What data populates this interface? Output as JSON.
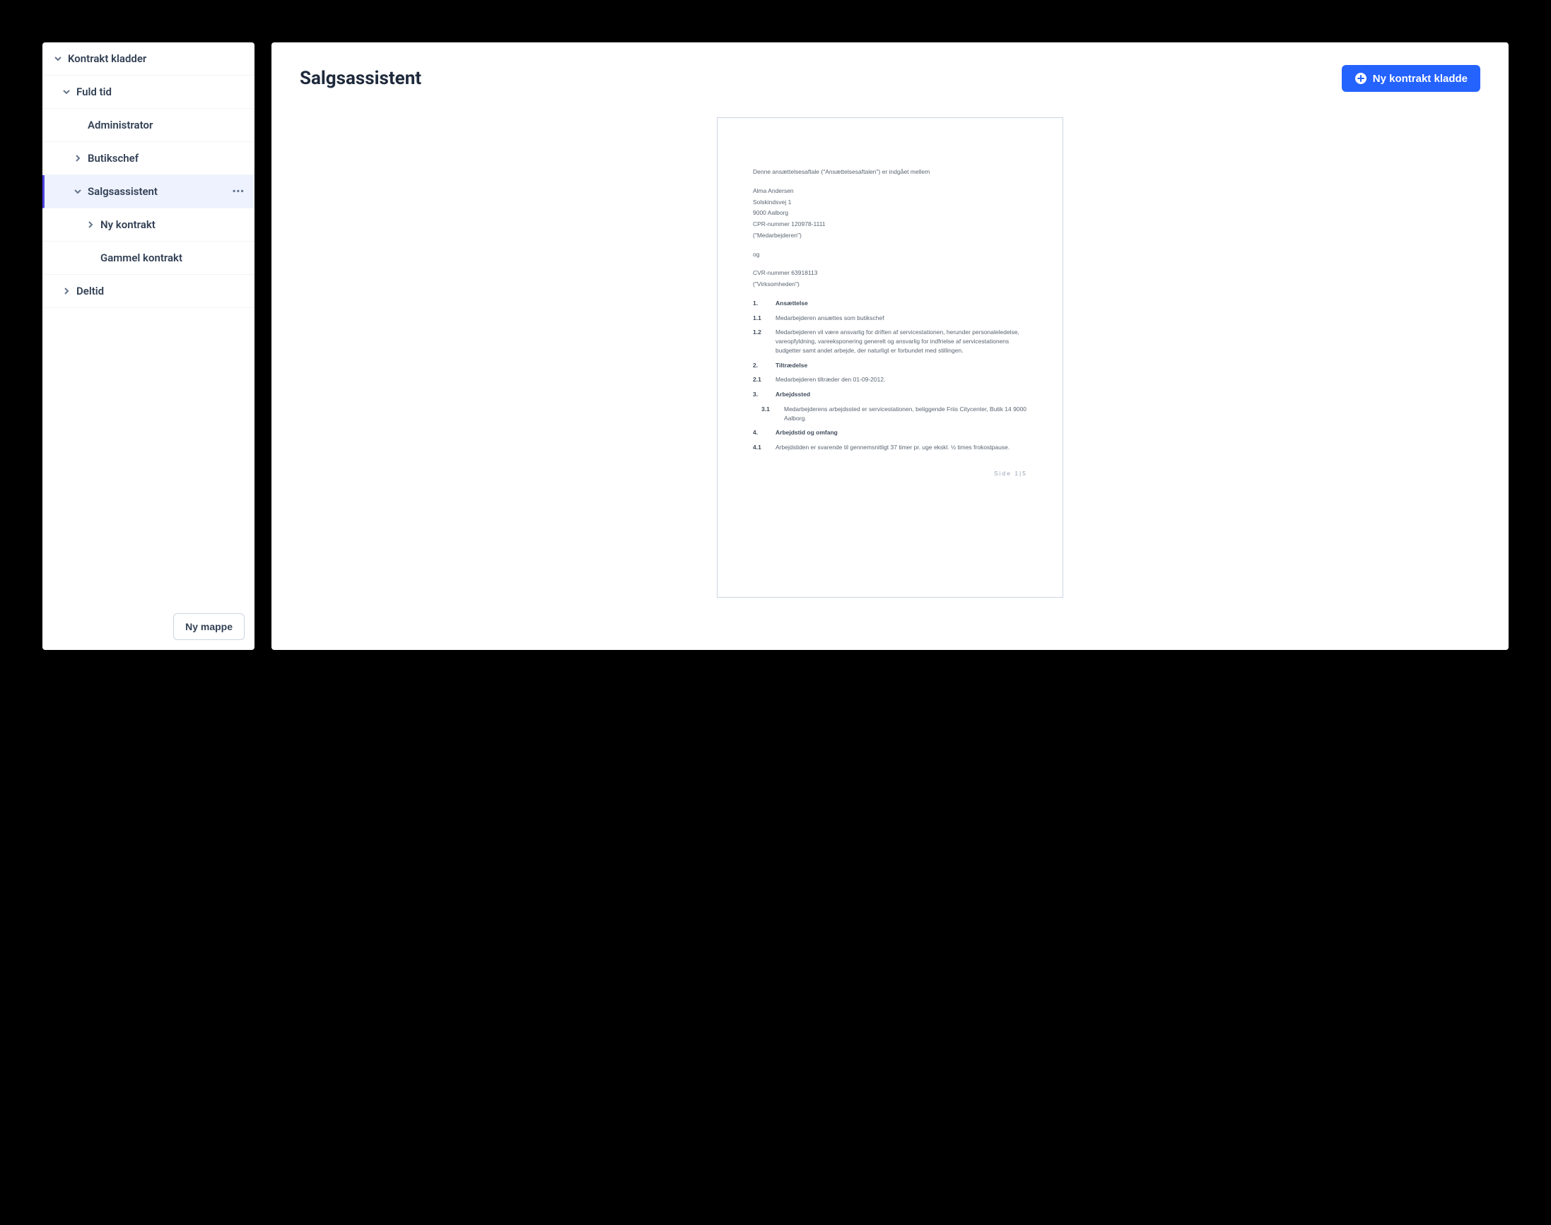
{
  "sidebar": {
    "root_label": "Kontrakt kladder",
    "fuld_tid_label": "Fuld tid",
    "administrator_label": "Administrator",
    "butikschef_label": "Butikschef",
    "salgsassistent_label": "Salgsassistent",
    "ny_kontrakt_label": "Ny kontrakt",
    "gammel_kontrakt_label": "Gammel kontrakt",
    "deltid_label": "Deltid",
    "new_folder_label": "Ny mappe"
  },
  "main": {
    "title": "Salgsassistent",
    "new_template_label": "Ny kontrakt kladde"
  },
  "doc": {
    "intro": "Denne ansættelsesaftale (\"Ansættelsesaftalen\") er indgået mellem",
    "party_a_name": "Alma Andersen",
    "party_a_street": "Solskindsvej 1",
    "party_a_city": "9000 Aalborg",
    "party_a_cpr": "CPR-nummer 120978-1111",
    "party_a_role": "(\"Medarbejderen\")",
    "and_word": "og",
    "party_b_cvr": "CVR-nummer 63918113",
    "party_b_role": "(\"Virksomheden\")",
    "s1_num": "1.",
    "s1_title": "Ansættelse",
    "s1_1_num": "1.1",
    "s1_1_text": "Medarbejderen ansættes som butikschef",
    "s1_2_num": "1.2",
    "s1_2_text": "Medarbejderen vil være ansvarlig for driften af servicestationen, herunder personaleledelse, vareopfyldning, vareeksponering generelt og ansvarlig for indfrielse af servicestationens budgetter samt andet arbejde, der naturligt er forbundet med stillingen.",
    "s2_num": "2.",
    "s2_title": "Tiltrædelse",
    "s2_1_num": "2.1",
    "s2_1_text": "Medarbejderen tiltræder den 01-09-2012.",
    "s3_num": "3.",
    "s3_title": "Arbejdssted",
    "s3_1_num": "3.1",
    "s3_1_text": "Medarbejderens arbejdssted er servicestationen, beliggende Friis Citycenter, Butik 14 9000 Aalborg.",
    "s4_num": "4.",
    "s4_title": "Arbejdstid og omfang",
    "s4_1_num": "4.1",
    "s4_1_text": "Arbejdstiden er svarende til gennemsnitligt 37 timer pr. uge ekskl. ½ times frokostpause.",
    "page_footer": "Side 1|5"
  }
}
